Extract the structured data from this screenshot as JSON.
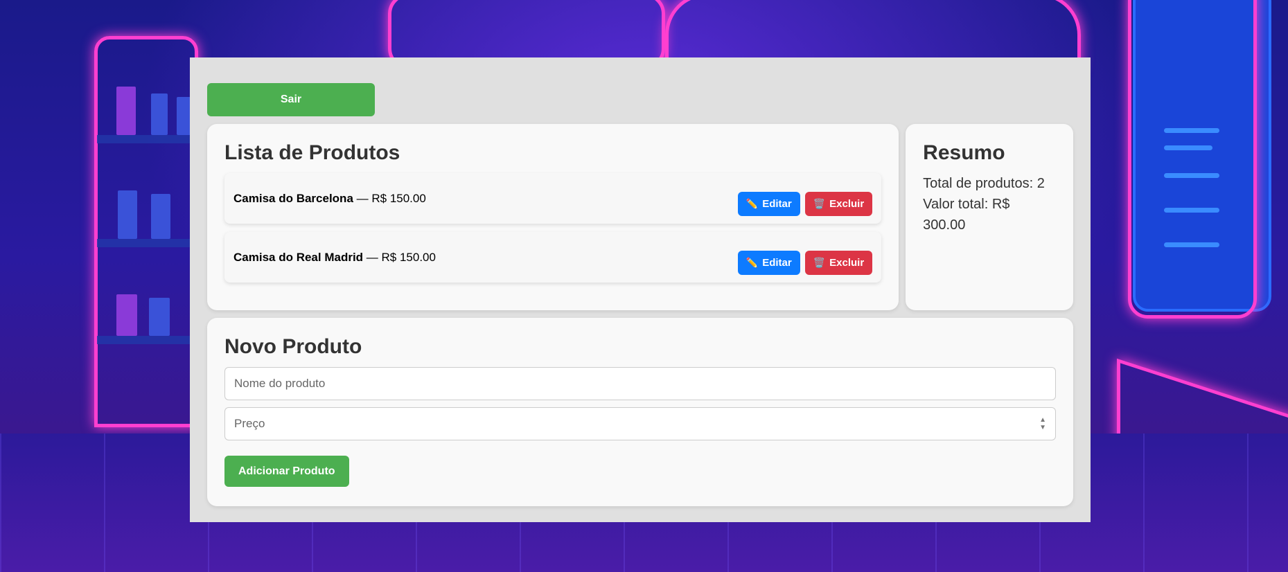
{
  "header": {
    "logout_label": "Sair"
  },
  "products": {
    "title": "Lista de Produtos",
    "items": [
      {
        "name": "Camisa do Barcelona",
        "price": "— R$ 150.00"
      },
      {
        "name": "Camisa do Real Madrid",
        "price": "— R$ 150.00"
      }
    ],
    "edit_label": "Editar",
    "delete_label": "Excluir",
    "edit_icon": "pencil-icon",
    "delete_icon": "trash-icon"
  },
  "summary": {
    "title": "Resumo",
    "total_products": "Total de produtos: 2",
    "total_value": "Valor total: R$ 300.00"
  },
  "new_product": {
    "title": "Novo Produto",
    "name_placeholder": "Nome do produto",
    "price_placeholder": "Preço",
    "add_label": "Adicionar Produto"
  },
  "colors": {
    "primary_green": "#4caf50",
    "edit_blue": "#0d7bff",
    "delete_red": "#dc3545"
  }
}
